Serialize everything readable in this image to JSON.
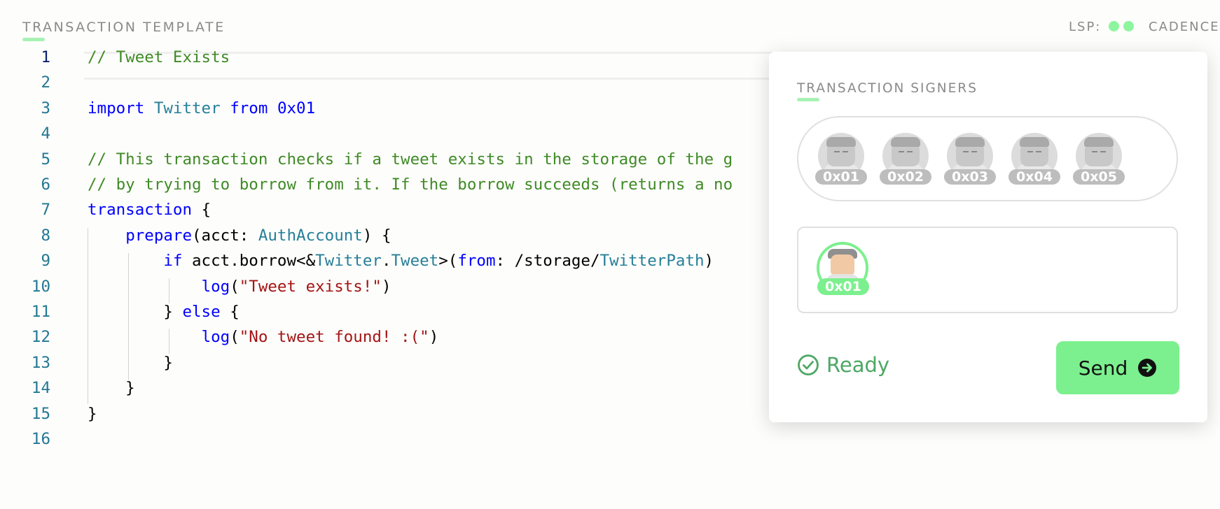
{
  "header": {
    "title": "TRANSACTION TEMPLATE",
    "lsp_label": "LSP:",
    "cadence_label": "CADENCE"
  },
  "editor": {
    "lines": [
      {
        "n": "1",
        "segments": [
          {
            "t": "// Tweet Exists",
            "c": "cm"
          }
        ]
      },
      {
        "n": "2",
        "segments": []
      },
      {
        "n": "3",
        "segments": [
          {
            "t": "import",
            "c": "kw"
          },
          {
            "t": " ",
            "c": "tx"
          },
          {
            "t": "Twitter",
            "c": "ty"
          },
          {
            "t": " ",
            "c": "tx"
          },
          {
            "t": "from",
            "c": "kw"
          },
          {
            "t": " ",
            "c": "tx"
          },
          {
            "t": "0x01",
            "c": "kw"
          }
        ]
      },
      {
        "n": "4",
        "segments": []
      },
      {
        "n": "5",
        "segments": [
          {
            "t": "// This transaction checks if a tweet exists in the storage of the g",
            "c": "cm"
          }
        ]
      },
      {
        "n": "6",
        "segments": [
          {
            "t": "// by trying to borrow from it. If the borrow succeeds (returns a no",
            "c": "cm"
          }
        ]
      },
      {
        "n": "7",
        "segments": [
          {
            "t": "transaction",
            "c": "kw"
          },
          {
            "t": " {",
            "c": "tx"
          }
        ]
      },
      {
        "n": "8",
        "segments": [
          {
            "t": "    ",
            "c": "tx"
          },
          {
            "t": "prepare",
            "c": "kw"
          },
          {
            "t": "(acct: ",
            "c": "tx"
          },
          {
            "t": "AuthAccount",
            "c": "ty"
          },
          {
            "t": ") {",
            "c": "tx"
          }
        ]
      },
      {
        "n": "9",
        "segments": [
          {
            "t": "        ",
            "c": "tx"
          },
          {
            "t": "if",
            "c": "kw"
          },
          {
            "t": " acct.borrow<&",
            "c": "tx"
          },
          {
            "t": "Twitter",
            "c": "ty"
          },
          {
            "t": ".",
            "c": "tx"
          },
          {
            "t": "Tweet",
            "c": "ty"
          },
          {
            "t": ">(",
            "c": "tx"
          },
          {
            "t": "from",
            "c": "kw"
          },
          {
            "t": ": /storage/",
            "c": "tx"
          },
          {
            "t": "TwitterPath",
            "c": "ty"
          },
          {
            "t": ")",
            "c": "tx"
          }
        ]
      },
      {
        "n": "10",
        "segments": [
          {
            "t": "            ",
            "c": "tx"
          },
          {
            "t": "log",
            "c": "kw"
          },
          {
            "t": "(",
            "c": "tx"
          },
          {
            "t": "\"Tweet exists!\"",
            "c": "st"
          },
          {
            "t": ")",
            "c": "tx"
          }
        ]
      },
      {
        "n": "11",
        "segments": [
          {
            "t": "        } ",
            "c": "tx"
          },
          {
            "t": "else",
            "c": "kw"
          },
          {
            "t": " {",
            "c": "tx"
          }
        ]
      },
      {
        "n": "12",
        "segments": [
          {
            "t": "            ",
            "c": "tx"
          },
          {
            "t": "log",
            "c": "kw"
          },
          {
            "t": "(",
            "c": "tx"
          },
          {
            "t": "\"No tweet found! :(\"",
            "c": "st"
          },
          {
            "t": ")",
            "c": "tx"
          }
        ]
      },
      {
        "n": "13",
        "segments": [
          {
            "t": "        }",
            "c": "tx"
          }
        ]
      },
      {
        "n": "14",
        "segments": [
          {
            "t": "    }",
            "c": "tx"
          }
        ]
      },
      {
        "n": "15",
        "segments": [
          {
            "t": "}",
            "c": "tx"
          }
        ]
      },
      {
        "n": "16",
        "segments": []
      }
    ]
  },
  "panel": {
    "title": "TRANSACTION SIGNERS",
    "accounts": [
      "0x01",
      "0x02",
      "0x03",
      "0x04",
      "0x05"
    ],
    "selected_signer": "0x01",
    "status_label": "Ready",
    "send_label": "Send"
  },
  "colors": {
    "accent": "#7cf08e",
    "status_ready": "#4da763"
  },
  "icons": {
    "status": "check-circle-icon",
    "send": "arrow-right-circle-icon"
  }
}
